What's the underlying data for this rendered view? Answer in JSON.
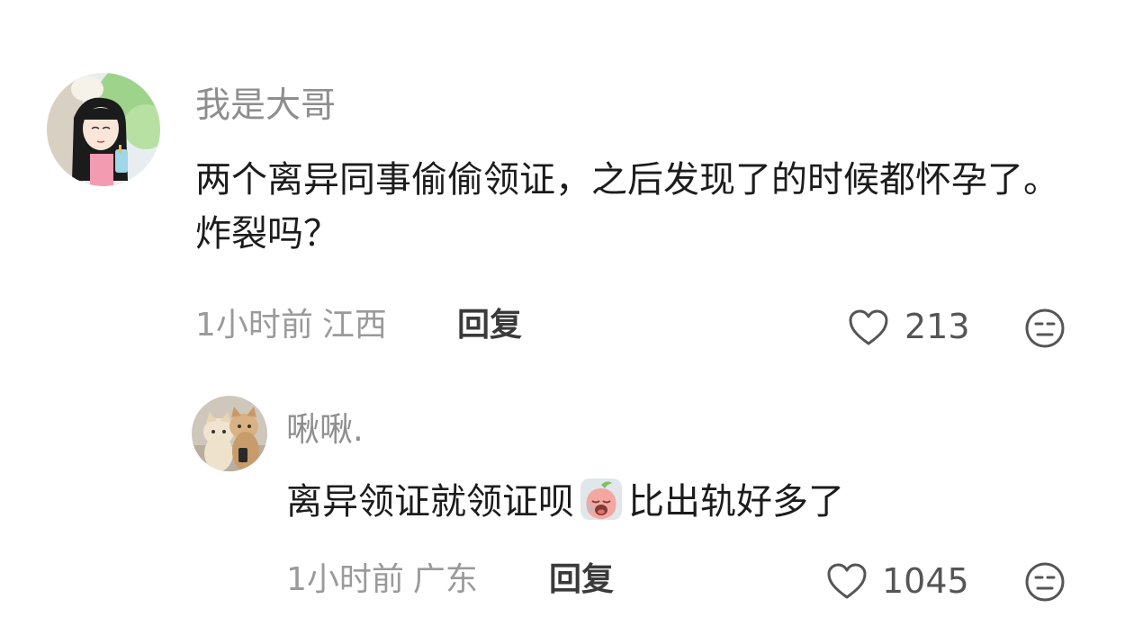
{
  "comment": {
    "username": "我是大哥",
    "text": "两个离异同事偷偷领证，之后发现了的时候都怀孕了。炸裂吗？",
    "time": "1小时前",
    "location": "江西",
    "reply_label": "回复",
    "like_count": "213",
    "avatar_icon": "anime-girl-avatar"
  },
  "reply": {
    "username": "啾啾.",
    "text_before": "离异领证就领证呗",
    "emoji_icon": "crying-peach-emoji",
    "text_after": "比出轨好多了",
    "time": "1小时前",
    "location": "广东",
    "reply_label": "回复",
    "like_count": "1045",
    "avatar_icon": "cats-photo-avatar"
  },
  "colors": {
    "username": "#8e8e8e",
    "text": "#1c1c1c",
    "meta": "#9a9a9a",
    "reply_button": "#3a3a3a",
    "icon": "#555555"
  }
}
